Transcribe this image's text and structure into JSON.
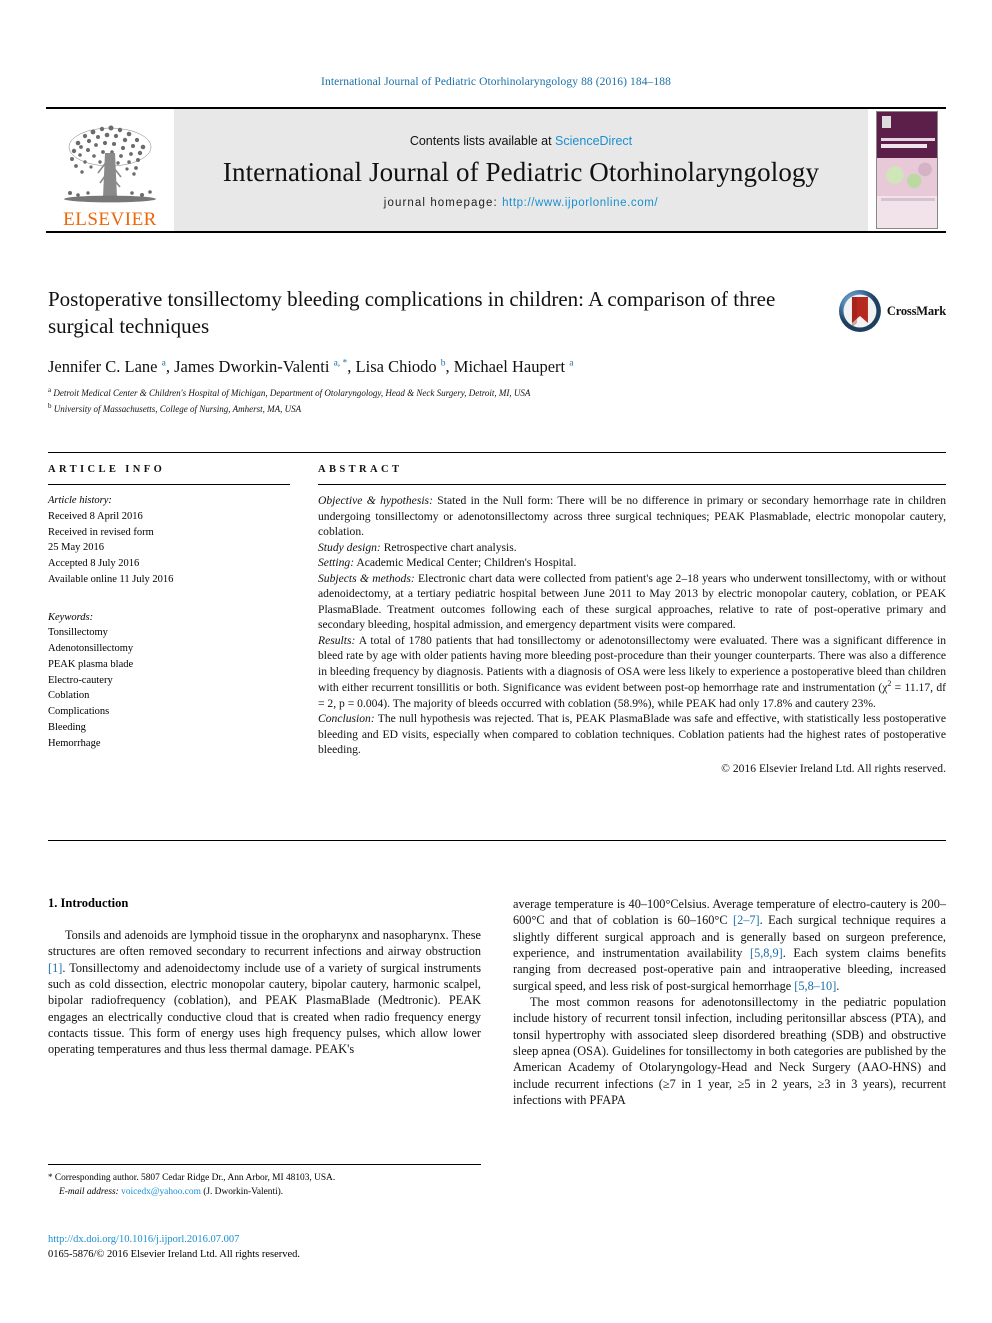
{
  "running_head": "International Journal of Pediatric Otorhinolaryngology 88 (2016) 184–188",
  "masthead": {
    "publisher": "ELSEVIER",
    "contents_prefix": "Contents lists available at ",
    "contents_link": "ScienceDirect",
    "journal_title": "International Journal of Pediatric Otorhinolaryngology",
    "homepage_prefix": "journal homepage: ",
    "homepage_url": "http://www.ijporlonline.com/",
    "cover_alt": "Pediatric Otorhinolaryngology journal cover"
  },
  "article": {
    "title": "Postoperative tonsillectomy bleeding complications in children: A comparison of three surgical techniques",
    "authors": "Jennifer C. Lane a, James Dworkin-Valenti a, *, Lisa Chiodo b, Michael Haupert a",
    "affiliation_a": "Detroit Medical Center & Children's Hospital of Michigan, Department of Otolaryngology, Head & Neck Surgery, Detroit, MI, USA",
    "affiliation_b": "University of Massachusetts, College of Nursing, Amherst, MA, USA",
    "crossmark_label": "CrossMark"
  },
  "article_info": {
    "heading": "ARTICLE INFO",
    "history_label": "Article history:",
    "history": [
      "Received 8 April 2016",
      "Received in revised form",
      "25 May 2016",
      "Accepted 8 July 2016",
      "Available online 11 July 2016"
    ],
    "keywords_label": "Keywords:",
    "keywords": [
      "Tonsillectomy",
      "Adenotonsillectomy",
      "PEAK plasma blade",
      "Electro-cautery",
      "Coblation",
      "Complications",
      "Bleeding",
      "Hemorrhage"
    ]
  },
  "abstract": {
    "heading": "ABSTRACT",
    "objective_label": "Objective & hypothesis:",
    "objective_text": " Stated in the Null form: There will be no difference in primary or secondary hemorrhage rate in children undergoing tonsillectomy or adenotonsillectomy across three surgical techniques; PEAK Plasmablade, electric monopolar cautery, coblation.",
    "design_label": "Study design:",
    "design_text": " Retrospective chart analysis.",
    "setting_label": "Setting:",
    "setting_text": " Academic Medical Center; Children's Hospital.",
    "subjects_label": "Subjects & methods:",
    "subjects_text": " Electronic chart data were collected from patient's age 2–18 years who underwent tonsillectomy, with or without adenoidectomy, at a tertiary pediatric hospital between June 2011 to May 2013 by electric monopolar cautery, coblation, or PEAK PlasmaBlade. Treatment outcomes following each of these surgical approaches, relative to rate of post-operative primary and secondary bleeding, hospital admission, and emergency department visits were compared.",
    "results_label": "Results:",
    "results_text_1": " A total of 1780 patients that had tonsillectomy or adenotonsillectomy were evaluated. There was a significant difference in bleed rate by age with older patients having more bleeding post-procedure than their younger counterparts. There was also a difference in bleeding frequency by diagnosis. Patients with a diagnosis of OSA were less likely to experience a postoperative bleed than children with either recurrent tonsillitis or both. Significance was evident between post-op hemorrhage rate and instrumentation (χ",
    "results_sup": "2",
    "results_text_2": " = 11.17, df = 2, p = 0.004). The majority of bleeds occurred with coblation (58.9%), while PEAK had only 17.8% and cautery 23%.",
    "conclusion_label": "Conclusion:",
    "conclusion_text": " The null hypothesis was rejected. That is, PEAK PlasmaBlade was safe and effective, with statistically less postoperative bleeding and ED visits, especially when compared to coblation techniques. Coblation patients had the highest rates of postoperative bleeding.",
    "copyright": "© 2016 Elsevier Ireland Ltd. All rights reserved."
  },
  "introduction": {
    "number_title": "1. Introduction",
    "left_p1_a": "Tonsils and adenoids are lymphoid tissue in the oropharynx and nasopharynx. These structures are often removed secondary to recurrent infections and airway obstruction ",
    "left_ref1": "[1]",
    "left_p1_b": ". Tonsillectomy and adenoidectomy include use of a variety of surgical instruments such as cold dissection, electric monopolar cautery, bipolar cautery, harmonic scalpel, bipolar radiofrequency (coblation), and PEAK PlasmaBlade (Medtronic). PEAK engages an electrically conductive cloud that is created when radio frequency energy contacts tissue. This form of energy uses high frequency pulses, which allow lower operating temperatures and thus less thermal damage. PEAK's",
    "right_p1_a": "average temperature is 40–100°Celsius. Average temperature of electro-cautery is 200–600°C and that of coblation is 60–160°C ",
    "right_ref1": "[2–7]",
    "right_p1_b": ". Each surgical technique requires a slightly different surgical approach and is generally based on surgeon preference, experience, and instrumentation availability ",
    "right_ref2": "[5,8,9]",
    "right_p1_c": ". Each system claims benefits ranging from decreased post-operative pain and intraoperative bleeding, increased surgical speed, and less risk of post-surgical hemorrhage ",
    "right_ref3": "[5,8–10]",
    "right_p1_d": ".",
    "right_p2": "The most common reasons for adenotonsillectomy in the pediatric population include history of recurrent tonsil infection, including peritonsillar abscess (PTA), and tonsil hypertrophy with associated sleep disordered breathing (SDB) and obstructive sleep apnea (OSA). Guidelines for tonsillectomy in both categories are published by the American Academy of Otolaryngology-Head and Neck Surgery (AAO-HNS) and include recurrent infections (≥7 in 1 year, ≥5 in 2 years, ≥3 in 3 years), recurrent infections with PFAPA"
  },
  "footer": {
    "corresponding_marker": "*",
    "corresponding_text": " Corresponding author. 5807 Cedar Ridge Dr., Ann Arbor, MI 48103, USA.",
    "email_label": "E-mail address:",
    "email": "voicedx@yahoo.com",
    "email_suffix": " (J. Dworkin-Valenti).",
    "doi": "http://dx.doi.org/10.1016/j.ijporl.2016.07.007",
    "issn_line": "0165-5876/© 2016 Elsevier Ireland Ltd. All rights reserved."
  },
  "colors": {
    "link": "#1a8fd0",
    "running_head": "#1a6fa8",
    "elsevier_orange": "#ec6707",
    "band_gray": "#e8e8e8"
  }
}
